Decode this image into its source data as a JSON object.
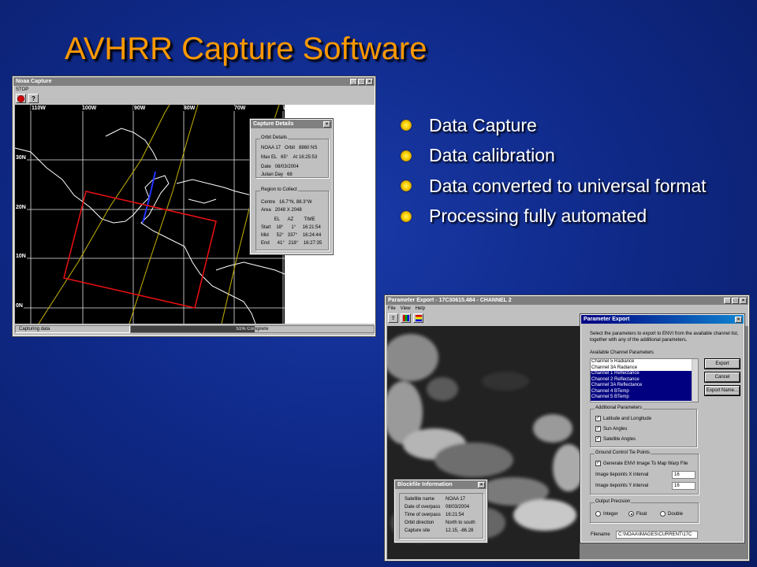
{
  "slide": {
    "title": "AVHRR Capture Software",
    "bullets": [
      "Data Capture",
      "Data calibration",
      "Data converted to universal format",
      "Processing fully automated"
    ]
  },
  "noaa_capture": {
    "title": "Noaa Capture",
    "menu": [
      "STOP"
    ],
    "tool_icons": [
      "stop-icon",
      "help-icon"
    ],
    "longitudes": [
      "110W",
      "100W",
      "90W",
      "80W",
      "70W",
      "L"
    ],
    "latitudes": [
      "30N",
      "20N",
      "10N",
      "0N"
    ],
    "status_text": "Capturing data",
    "progress_pct": 51,
    "progress_label": "51% Complete"
  },
  "capture_details": {
    "title": "Capture Details",
    "orbit_group": "Orbit Details",
    "orbit_lines": [
      "NOAA 17   Orbit   8860 NS",
      "Max EL   65°    At 16:25:53",
      "Date   08/03/2004",
      "Julian Day   68"
    ],
    "region_group": "Region to Collect",
    "region_lines": [
      "Centre   16.7°N, 88.3°W",
      "Area   2048 X 2048"
    ],
    "table_header": "          EL      AZ        TIME",
    "table_rows": [
      "Start    18°      1°     16:21:54",
      "Mid      52°   337°    16:24:44",
      "End      41°   218°    16:27:35"
    ]
  },
  "parameter_export_window": {
    "title": "Parameter Export - 17C30615.484 - CHANNEL 2",
    "menu": [
      "File",
      "View",
      "Help"
    ]
  },
  "parameter_export_dialog": {
    "title": "Parameter Export",
    "description": "Select the parameters to export to ENVI from the available channel list, together with any of the additional parameters.",
    "list_label": "Available Channel Parameters",
    "channels": [
      {
        "label": "Channel 5 Radiance",
        "selected": false
      },
      {
        "label": "Channel 3A Radiance",
        "selected": false
      },
      {
        "label": "Channel 1 Reflectance",
        "selected": true
      },
      {
        "label": "Channel 2 Reflectance",
        "selected": true
      },
      {
        "label": "Channel 3A Reflectance",
        "selected": true
      },
      {
        "label": "Channel 4 BTemp",
        "selected": true
      },
      {
        "label": "Channel 5 BTemp",
        "selected": true
      }
    ],
    "buttons": [
      "Export",
      "Cancel",
      "Export Name..."
    ],
    "additional_group": "Additional Parameters",
    "additional": [
      "Latitude and Longitude",
      "Sun Angles",
      "Satellite Angles"
    ],
    "gcp_group": "Ground Control Tie Points",
    "gcp_check": "Generate ENVI Image To Map Warp File",
    "x_interval_label": "Image tiepoints X interval",
    "x_interval_value": "16",
    "y_interval_label": "Image tiepoints Y interval",
    "y_interval_value": "16",
    "precision_group": "Output Precision",
    "precision_options": [
      "Integer",
      "Float",
      "Double"
    ],
    "precision_selected": "Float",
    "filename_label": "Filename",
    "filename_value": "C:\\NOAA\\IMAGES\\CURRENT\\17C"
  },
  "blockfile": {
    "title": "Blockfile Information",
    "rows": [
      {
        "label": "Satellite name",
        "value": "NOAA 17"
      },
      {
        "label": "Date of overpass",
        "value": "08/03/2004"
      },
      {
        "label": "Time of overpass",
        "value": "16:21:54"
      },
      {
        "label": "Orbit direction",
        "value": "North to south"
      },
      {
        "label": "Capture site",
        "value": "12.15, -86.28"
      }
    ]
  },
  "colors": {
    "title": "#ff9900",
    "bullet": "#ffd400",
    "swath_box": "#e01010",
    "track_yellow": "#c8b400",
    "track_blue": "#2233ff"
  }
}
